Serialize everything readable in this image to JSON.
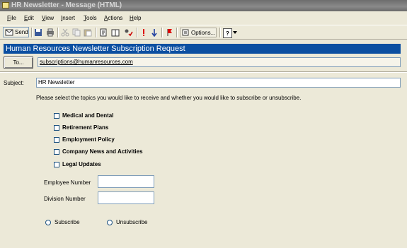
{
  "window": {
    "title": "HR Newsletter - Message (HTML)"
  },
  "menubar": {
    "items": [
      {
        "label": "File",
        "u": "F",
        "rest": "ile"
      },
      {
        "label": "Edit",
        "u": "E",
        "rest": "dit"
      },
      {
        "label": "View",
        "u": "V",
        "rest": "iew"
      },
      {
        "label": "Insert",
        "u": "I",
        "rest": "nsert"
      },
      {
        "label": "Tools",
        "u": "T",
        "rest": "ools"
      },
      {
        "label": "Actions",
        "u": "A",
        "rest": "ctions"
      },
      {
        "label": "Help",
        "u": "H",
        "rest": "elp"
      }
    ]
  },
  "toolbar": {
    "send_label": "Send",
    "options_label": "Options...",
    "help_label": "?"
  },
  "form": {
    "banner": "Human Resources Newsletter Subscription Request",
    "to_label": "To...",
    "to_value": "subscriptions@humanresources.com",
    "subject_label": "Subject:",
    "subject_value": "HR Newsletter",
    "instructions": "Please select the topics you would like to receive and whether you would like to subscribe or unsubscribe.",
    "topics": [
      "Medical and Dental",
      "Retirement Plans",
      "Employment Policy",
      "Company News and Activities",
      "Legal Updates"
    ],
    "employee_number_label": "Employee Number",
    "division_number_label": "Division Number",
    "subscribe_label": "Subscribe",
    "unsubscribe_label": "Unsubscribe"
  },
  "colors": {
    "banner": "#0b4fa1",
    "titlebar": "#7a7a7a",
    "background": "#ece9d8"
  }
}
